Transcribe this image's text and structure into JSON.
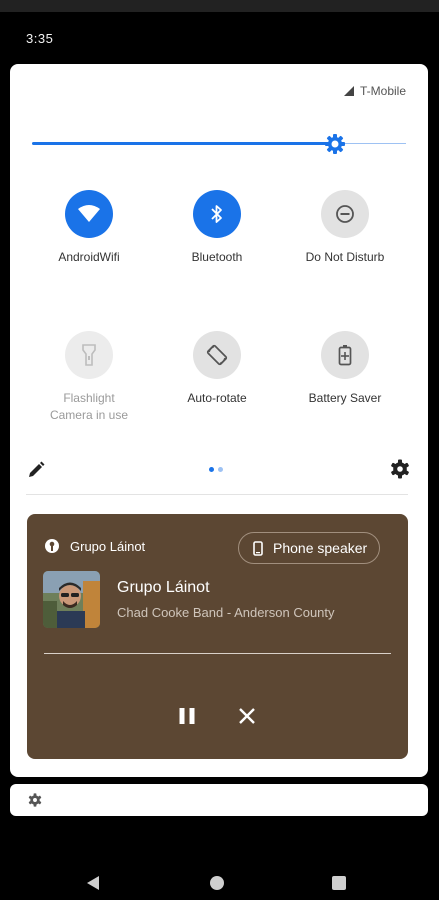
{
  "status_bar": {
    "time": "3:35"
  },
  "quick_settings": {
    "carrier": "T-Mobile",
    "brightness_level": 0.81,
    "tiles": [
      {
        "label": "AndroidWifi",
        "state": "on",
        "icon": "wifi-icon"
      },
      {
        "label": "Bluetooth",
        "state": "on",
        "icon": "bluetooth-icon"
      },
      {
        "label": "Do Not Disturb",
        "state": "off",
        "icon": "do-not-disturb-icon"
      },
      {
        "label": "Flashlight",
        "sublabel": "Camera in use",
        "state": "unavailable",
        "icon": "flashlight-icon"
      },
      {
        "label": "Auto-rotate",
        "state": "off",
        "icon": "auto-rotate-icon"
      },
      {
        "label": "Battery Saver",
        "state": "off",
        "icon": "battery-saver-icon"
      }
    ],
    "page_indicator": {
      "pages": 2,
      "current": 1
    }
  },
  "media": {
    "app_name": "Grupo Láinot",
    "output_device": "Phone speaker",
    "title": "Grupo Láinot",
    "artist": "Chad Cooke Band - Anderson County",
    "background_color": "#5c4733"
  },
  "colors": {
    "accent": "#1a73e8",
    "tile_off": "#e2e2e2"
  }
}
